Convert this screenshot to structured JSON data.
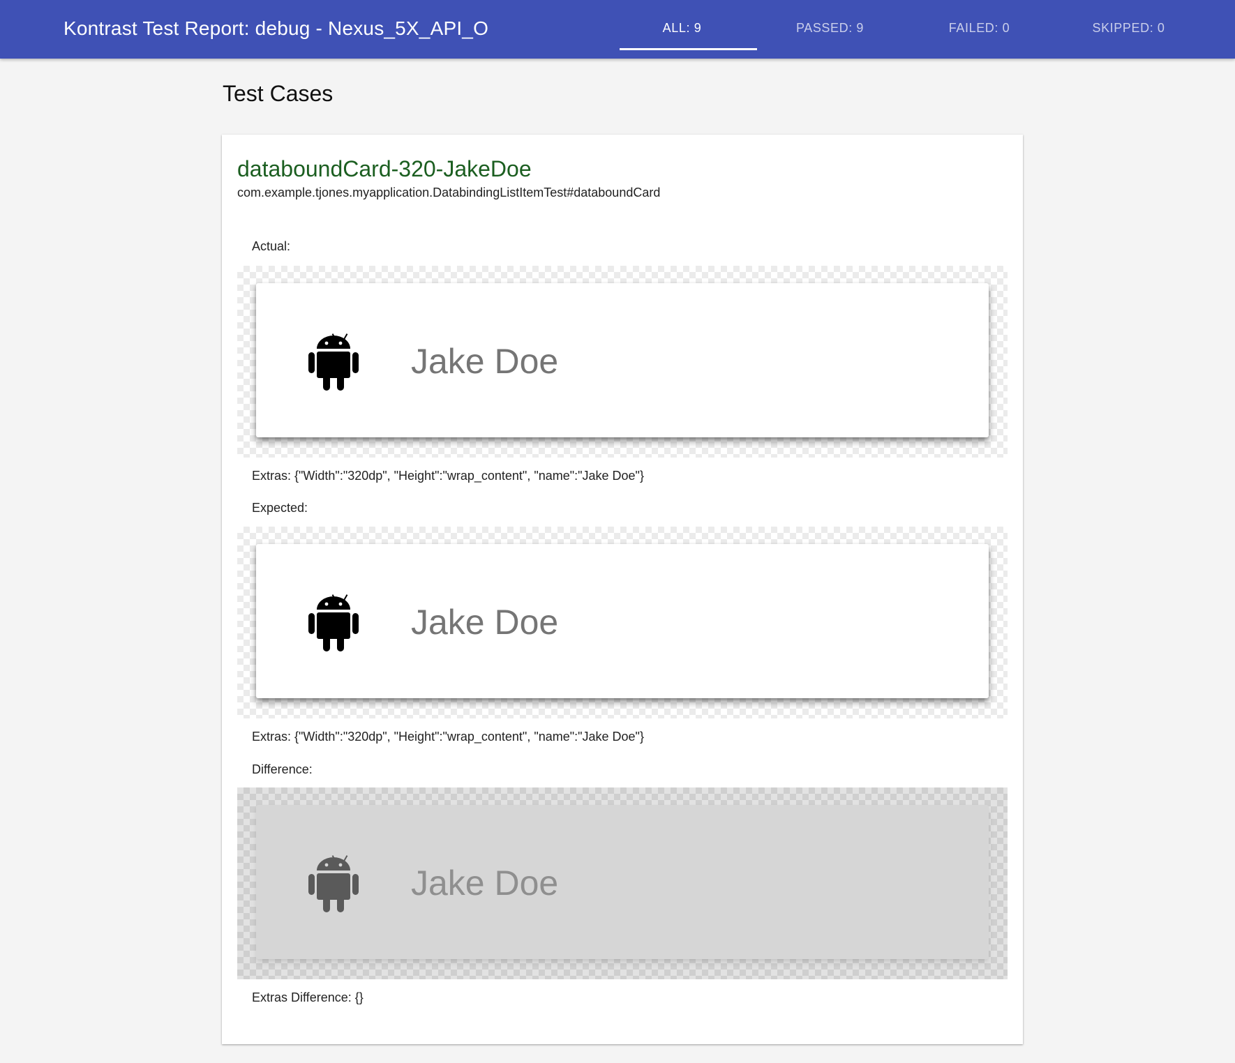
{
  "header": {
    "title": "Kontrast Test Report: debug - Nexus_5X_API_O",
    "tabs": [
      {
        "label": "ALL: 9",
        "active": true
      },
      {
        "label": "PASSED: 9",
        "active": false
      },
      {
        "label": "FAILED: 0",
        "active": false
      },
      {
        "label": "SKIPPED: 0",
        "active": false
      }
    ],
    "bar_color": "#3f51b5"
  },
  "main": {
    "section_title": "Test Cases",
    "test_case": {
      "name": "databoundCard-320-JakeDoe",
      "name_color": "#1b5e20",
      "class": "com.example.tjones.myapplication.DatabindingListItemTest#databoundCard",
      "actual": {
        "label": "Actual:",
        "preview_name": "Jake Doe",
        "icon": "android-icon",
        "extras": "Extras: {\"Width\":\"320dp\", \"Height\":\"wrap_content\", \"name\":\"Jake Doe\"}"
      },
      "expected": {
        "label": "Expected:",
        "preview_name": "Jake Doe",
        "icon": "android-icon",
        "extras": "Extras: {\"Width\":\"320dp\", \"Height\":\"wrap_content\", \"name\":\"Jake Doe\"}"
      },
      "difference": {
        "label": "Difference:",
        "preview_name": "Jake Doe",
        "icon": "android-icon",
        "extras": "Extras Difference: {}"
      }
    }
  }
}
